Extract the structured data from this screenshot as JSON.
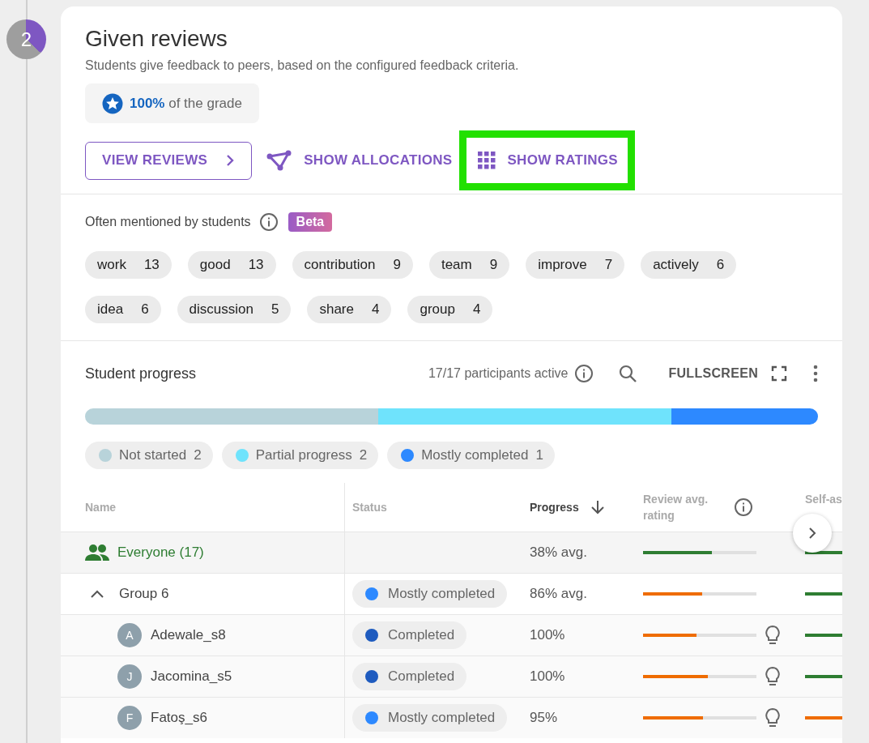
{
  "step": {
    "number": "2"
  },
  "card": {
    "title": "Given reviews",
    "subtitle": "Students give feedback to peers, based on the configured feedback criteria.",
    "grade": "**100%** of the grade",
    "actions": [
      {
        "kind": "outlined",
        "label": "VIEW REVIEWS",
        "highlighted": false
      },
      {
        "kind": "allocations",
        "label": "SHOW ALLOCATIONS",
        "highlighted": false
      },
      {
        "kind": "ratings",
        "label": "SHOW RATINGS",
        "highlighted": true
      }
    ]
  },
  "mentions": {
    "label": "Often mentioned by students",
    "badge": "Beta",
    "words": [
      {
        "word": "work",
        "count": "13"
      },
      {
        "word": "good",
        "count": "13"
      },
      {
        "word": "contribution",
        "count": "9"
      },
      {
        "word": "team",
        "count": "9"
      },
      {
        "word": "improve",
        "count": "7"
      },
      {
        "word": "actively",
        "count": "6"
      },
      {
        "word": "idea",
        "count": "6"
      },
      {
        "word": "discussion",
        "count": "5"
      },
      {
        "word": "share",
        "count": "4"
      },
      {
        "word": "group",
        "count": "4"
      }
    ]
  },
  "progress": {
    "title": "Student progress",
    "active": "17/17 participants active",
    "fullscreen": "FULLSCREEN",
    "legend": [
      {
        "label": "Not started",
        "count": "2",
        "color": "#b8d3da"
      },
      {
        "label": "Partial progress",
        "count": "2",
        "color": "#6fe3fc"
      },
      {
        "label": "Mostly completed",
        "count": "1",
        "color": "#2d89ff"
      }
    ]
  },
  "table": {
    "columns": [
      {
        "label": "Name",
        "sorted": false
      },
      {
        "label": "Status",
        "sorted": false
      },
      {
        "label": "Progress",
        "sorted": true
      },
      {
        "label": "Review avg. rating",
        "sorted": false
      },
      {
        "label": "Self-as",
        "sorted": false
      }
    ],
    "rows": [
      {
        "kind": "everyone",
        "name": "Everyone (17)",
        "progress": "38% avg.",
        "review": {
          "level": 0.61,
          "color": "#2e7d32"
        },
        "self": {
          "color": "#2e7d32"
        },
        "hint": false
      },
      {
        "kind": "group",
        "name": "Group 6",
        "expanded": true,
        "status": {
          "label": "Mostly completed",
          "color": "#2d89ff"
        },
        "progress": "86% avg.",
        "review": {
          "level": 0.52,
          "color": "#ef6c00"
        },
        "self": {
          "color": "#2e7d32"
        },
        "hint": false
      },
      {
        "kind": "student",
        "initial": "A",
        "name": "Adewale_s8",
        "status": {
          "label": "Completed",
          "color": "#1e5bbf"
        },
        "progress": "100%",
        "review": {
          "level": 0.47,
          "color": "#ef6c00"
        },
        "self": {
          "color": "#2e7d32"
        },
        "hint": true
      },
      {
        "kind": "student",
        "initial": "J",
        "name": "Jacomina_s5",
        "status": {
          "label": "Completed",
          "color": "#1e5bbf"
        },
        "progress": "100%",
        "review": {
          "level": 0.57,
          "color": "#ef6c00"
        },
        "self": {
          "color": "#2e7d32"
        },
        "hint": true
      },
      {
        "kind": "student",
        "initial": "F",
        "name": "Fatoş_s6",
        "status": {
          "label": "Mostly completed",
          "color": "#2d89ff"
        },
        "progress": "95%",
        "review": {
          "level": 0.53,
          "color": "#ef6c00"
        },
        "self": {
          "color": "#ef6c00"
        },
        "hint": true
      }
    ]
  }
}
